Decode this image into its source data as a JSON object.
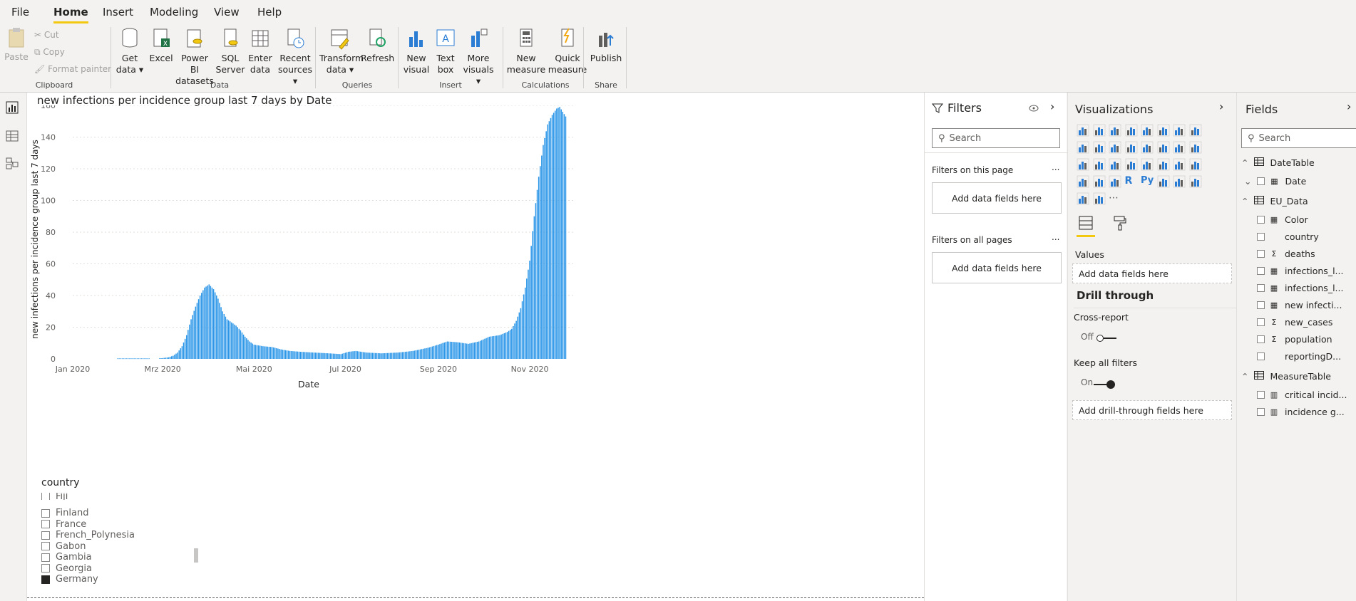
{
  "menu": {
    "items": [
      "File",
      "Home",
      "Insert",
      "Modeling",
      "View",
      "Help"
    ],
    "active": "Home"
  },
  "ribbon": {
    "clipboard": {
      "paste": "Paste",
      "cut": "Cut",
      "copy": "Copy",
      "format_painter": "Format painter",
      "label": "Clipboard"
    },
    "data": {
      "get_data": "Get data",
      "excel": "Excel",
      "power_bi": "Power BI datasets",
      "sql": "SQL Server",
      "enter_data": "Enter data",
      "recent": "Recent sources",
      "label": "Data"
    },
    "queries": {
      "transform": "Transform data",
      "refresh": "Refresh",
      "label": "Queries"
    },
    "insert": {
      "new_visual": "New visual",
      "text_box": "Text box",
      "more_visuals": "More visuals",
      "label": "Insert"
    },
    "calculations": {
      "new_measure": "New measure",
      "quick_measure": "Quick measure",
      "label": "Calculations"
    },
    "share": {
      "publish": "Publish",
      "label": "Share"
    }
  },
  "chart": {
    "title": "new infections per incidence group last 7 days by Date",
    "accent": "#2b96e8"
  },
  "chart_data": {
    "type": "bar",
    "title": "new infections per incidence group last 7 days by Date",
    "xlabel": "Date",
    "ylabel": "new infections per incidence group last 7 days",
    "ylim": [
      0,
      160
    ],
    "yticks": [
      0,
      20,
      40,
      60,
      80,
      100,
      120,
      140,
      160
    ],
    "xticks": [
      "Jan 2020",
      "Mrz 2020",
      "Mai 2020",
      "Jul 2020",
      "Sep 2020",
      "Nov 2020"
    ],
    "xrange": [
      "2020-01-01",
      "2020-11-30"
    ],
    "grid": true,
    "series_points": [
      [
        "2020-01-31",
        0.3
      ],
      [
        "2020-02-20",
        0.3
      ],
      [
        "2020-02-27",
        0.3
      ],
      [
        "2020-03-01",
        0.5
      ],
      [
        "2020-03-05",
        1
      ],
      [
        "2020-03-08",
        2
      ],
      [
        "2020-03-11",
        4
      ],
      [
        "2020-03-14",
        8
      ],
      [
        "2020-03-17",
        15
      ],
      [
        "2020-03-20",
        25
      ],
      [
        "2020-03-23",
        33
      ],
      [
        "2020-03-26",
        40
      ],
      [
        "2020-03-29",
        45
      ],
      [
        "2020-04-01",
        47
      ],
      [
        "2020-04-04",
        44
      ],
      [
        "2020-04-07",
        38
      ],
      [
        "2020-04-10",
        30
      ],
      [
        "2020-04-13",
        25
      ],
      [
        "2020-04-16",
        23
      ],
      [
        "2020-04-19",
        21
      ],
      [
        "2020-04-22",
        18
      ],
      [
        "2020-04-25",
        14
      ],
      [
        "2020-04-28",
        11
      ],
      [
        "2020-05-01",
        9
      ],
      [
        "2020-05-07",
        8
      ],
      [
        "2020-05-13",
        7.5
      ],
      [
        "2020-05-19",
        6
      ],
      [
        "2020-05-25",
        5
      ],
      [
        "2020-06-01",
        4.5
      ],
      [
        "2020-06-10",
        4
      ],
      [
        "2020-06-20",
        3.5
      ],
      [
        "2020-06-28",
        3
      ],
      [
        "2020-07-03",
        4.5
      ],
      [
        "2020-07-08",
        5
      ],
      [
        "2020-07-15",
        4
      ],
      [
        "2020-07-25",
        3.5
      ],
      [
        "2020-08-05",
        4
      ],
      [
        "2020-08-15",
        5
      ],
      [
        "2020-08-25",
        7
      ],
      [
        "2020-09-01",
        9
      ],
      [
        "2020-09-07",
        11
      ],
      [
        "2020-09-14",
        10.5
      ],
      [
        "2020-09-21",
        9.5
      ],
      [
        "2020-09-28",
        11
      ],
      [
        "2020-10-05",
        14
      ],
      [
        "2020-10-12",
        15
      ],
      [
        "2020-10-17",
        17
      ],
      [
        "2020-10-20",
        19
      ],
      [
        "2020-10-23",
        24
      ],
      [
        "2020-10-26",
        32
      ],
      [
        "2020-10-29",
        45
      ],
      [
        "2020-11-01",
        62
      ],
      [
        "2020-11-04",
        90
      ],
      [
        "2020-11-07",
        115
      ],
      [
        "2020-11-10",
        135
      ],
      [
        "2020-11-13",
        148
      ],
      [
        "2020-11-16",
        154
      ],
      [
        "2020-11-19",
        158
      ],
      [
        "2020-11-21",
        159
      ],
      [
        "2020-11-23",
        156
      ],
      [
        "2020-11-25",
        153
      ]
    ]
  },
  "slicer": {
    "title": "country",
    "items": [
      {
        "label": "Fiji",
        "checked": false
      },
      {
        "label": "Finland",
        "checked": false
      },
      {
        "label": "France",
        "checked": false
      },
      {
        "label": "French_Polynesia",
        "checked": false
      },
      {
        "label": "Gabon",
        "checked": false
      },
      {
        "label": "Gambia",
        "checked": false
      },
      {
        "label": "Georgia",
        "checked": false
      },
      {
        "label": "Germany",
        "checked": true
      }
    ]
  },
  "filters": {
    "title": "Filters",
    "search_placeholder": "Search",
    "on_this_page": "Filters on this page",
    "on_all_pages": "Filters on all pages",
    "add_fields": "Add data fields here",
    "more": "..."
  },
  "visualizations": {
    "title": "Visualizations",
    "values_label": "Values",
    "add_fields": "Add data fields here",
    "drill_through": "Drill through",
    "cross_report": "Cross-report",
    "off": "Off",
    "keep_all_filters": "Keep all filters",
    "on": "On",
    "add_drill": "Add drill-through fields here",
    "ellipsis": "..."
  },
  "fields": {
    "title": "Fields",
    "search_placeholder": "Search",
    "tables": [
      {
        "name": "DateTable",
        "expanded": true,
        "fields": [
          {
            "name": "Date",
            "kind": "calendar",
            "subexpand": true
          }
        ]
      },
      {
        "name": "EU_Data",
        "expanded": true,
        "fields": [
          {
            "name": "Color",
            "kind": "table"
          },
          {
            "name": "country",
            "kind": "text"
          },
          {
            "name": "deaths",
            "kind": "sigma"
          },
          {
            "name": "infections_l...",
            "kind": "table"
          },
          {
            "name": "infections_l...",
            "kind": "table"
          },
          {
            "name": "new infecti...",
            "kind": "table"
          },
          {
            "name": "new_cases",
            "kind": "sigma"
          },
          {
            "name": "population",
            "kind": "sigma"
          },
          {
            "name": "reportingD...",
            "kind": "text"
          }
        ]
      },
      {
        "name": "MeasureTable",
        "expanded": true,
        "fields": [
          {
            "name": "critical incid...",
            "kind": "calc"
          },
          {
            "name": "incidence g...",
            "kind": "calc"
          }
        ]
      }
    ]
  }
}
